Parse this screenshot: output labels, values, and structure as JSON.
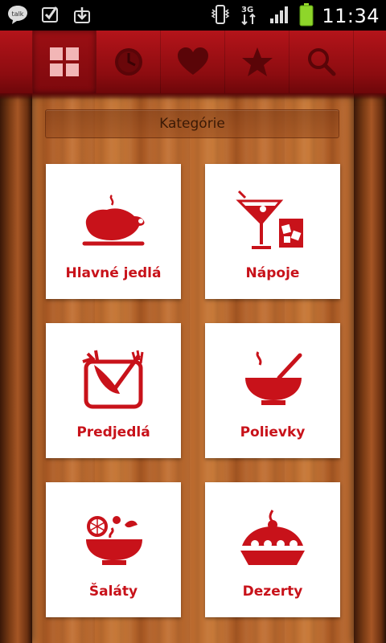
{
  "status_bar": {
    "talk_label": "talk",
    "network_label": "3G",
    "time": "11:34",
    "icons": [
      "talk-icon",
      "checkbox-icon",
      "download-icon",
      "vibrate-icon",
      "data-3g-icon",
      "signal-icon",
      "battery-icon"
    ]
  },
  "nav": {
    "items": [
      {
        "name": "categories",
        "icon": "grid-icon",
        "active": true
      },
      {
        "name": "recent",
        "icon": "clock-icon",
        "active": false
      },
      {
        "name": "favorites",
        "icon": "heart-icon",
        "active": false
      },
      {
        "name": "starred",
        "icon": "star-icon",
        "active": false
      },
      {
        "name": "search",
        "icon": "search-icon",
        "active": false
      }
    ]
  },
  "header": {
    "title": "Kategórie"
  },
  "categories": [
    {
      "label": "Hlavné jedlá",
      "icon": "roast-chicken-icon"
    },
    {
      "label": "Nápoje",
      "icon": "drinks-icon"
    },
    {
      "label": "Predjedlá",
      "icon": "cutting-board-icon"
    },
    {
      "label": "Polievky",
      "icon": "soup-bowl-icon"
    },
    {
      "label": "Šaláty",
      "icon": "salad-bowl-icon"
    },
    {
      "label": "Dezerty",
      "icon": "pie-icon"
    }
  ],
  "colors": {
    "accent": "#c8121a",
    "nav_bg": "#8c0c10",
    "wood": "#b9682c"
  }
}
